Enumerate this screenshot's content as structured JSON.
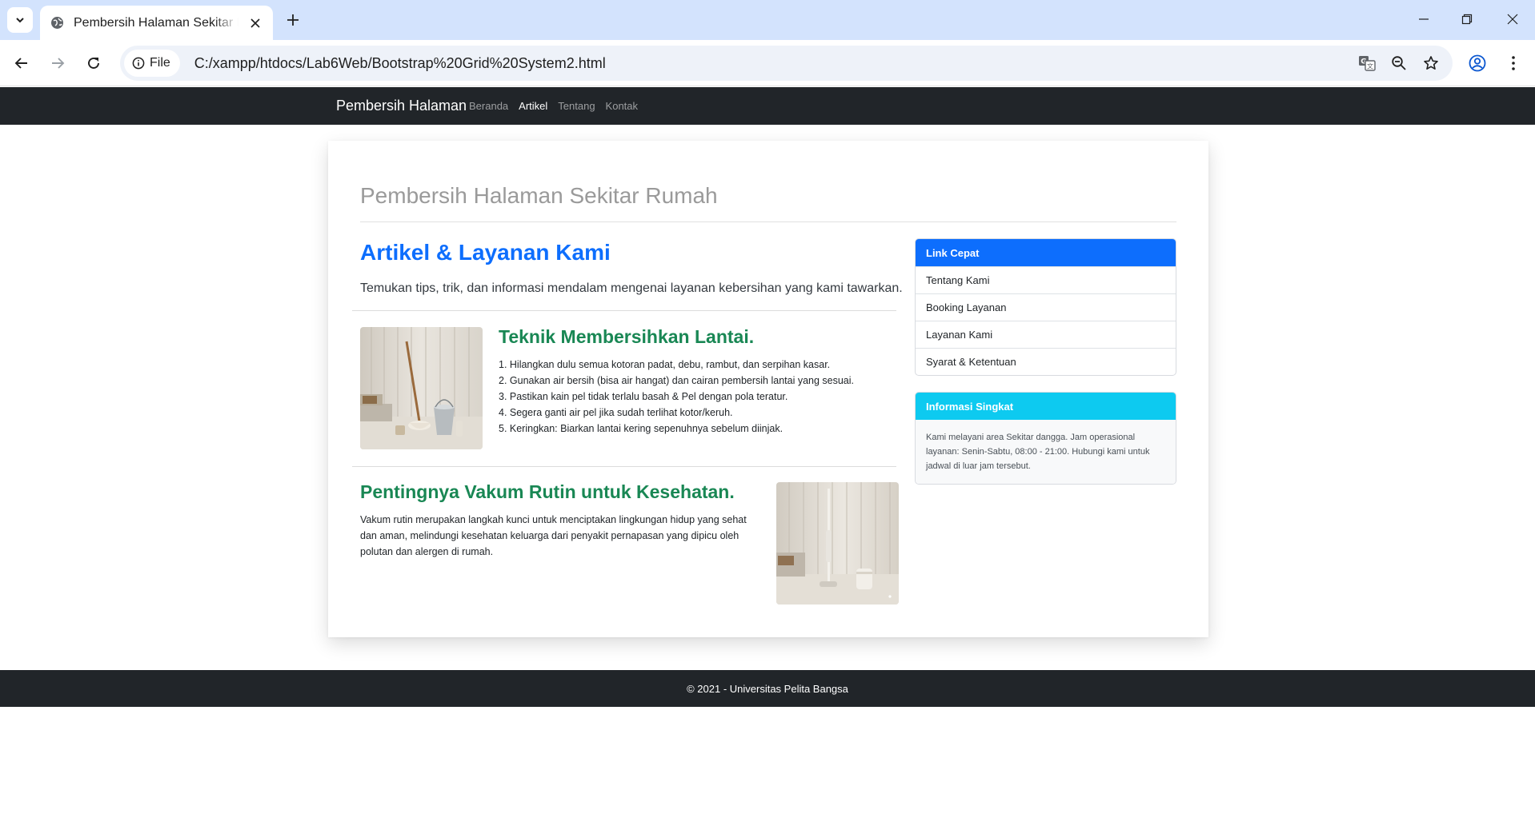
{
  "browser": {
    "tab_title": "Pembersih Halaman Sekitar Rumah",
    "chip_label": "File",
    "url": "C:/xampp/htdocs/Lab6Web/Bootstrap%20Grid%20System2.html"
  },
  "site": {
    "brand": "Pembersih Halaman",
    "nav": [
      "Beranda",
      "Artikel",
      "Tentang",
      "Kontak"
    ],
    "active_nav": "Artikel",
    "page_heading": "Pembersih Halaman Sekitar Rumah",
    "main_title": "Artikel & Layanan Kami",
    "lead": "Temukan tips, trik, dan informasi mendalam mengenai layanan kebersihan yang kami tawarkan."
  },
  "articles": [
    {
      "title": "Teknik Membersihkan Lantai.",
      "steps": [
        "1. Hilangkan dulu semua kotoran padat, debu, rambut, dan serpihan kasar.",
        "2. Gunakan air bersih (bisa air hangat) dan cairan pembersih lantai yang sesuai.",
        "3. Pastikan kain pel tidak terlalu basah & Pel dengan pola teratur.",
        "4. Segera ganti air pel jika sudah terlihat kotor/keruh.",
        "5. Keringkan: Biarkan lantai kering sepenuhnya sebelum diinjak."
      ]
    },
    {
      "title": "Pentingnya Vakum Rutin untuk Kesehatan.",
      "text": "Vakum rutin merupakan langkah kunci untuk menciptakan lingkungan hidup yang sehat dan aman, melindungi kesehatan keluarga dari penyakit pernapasan yang dipicu oleh polutan dan alergen di rumah."
    }
  ],
  "sidebar": {
    "quick_links_title": "Link Cepat",
    "quick_links": [
      "Tentang Kami",
      "Booking Layanan",
      "Layanan Kami",
      "Syarat & Ketentuan"
    ],
    "info_title": "Informasi Singkat",
    "info_text": "Kami melayani area Sekitar dangga. Jam operasional layanan: Senin-Sabtu, 08:00 - 21:00. Hubungi kami untuk jadwal di luar jam tersebut."
  },
  "footer": "© 2021 - Universitas Pelita Bangsa",
  "colors": {
    "primary": "#0d6efd",
    "success": "#198754",
    "info": "#0dcaf0",
    "dark": "#212529"
  }
}
